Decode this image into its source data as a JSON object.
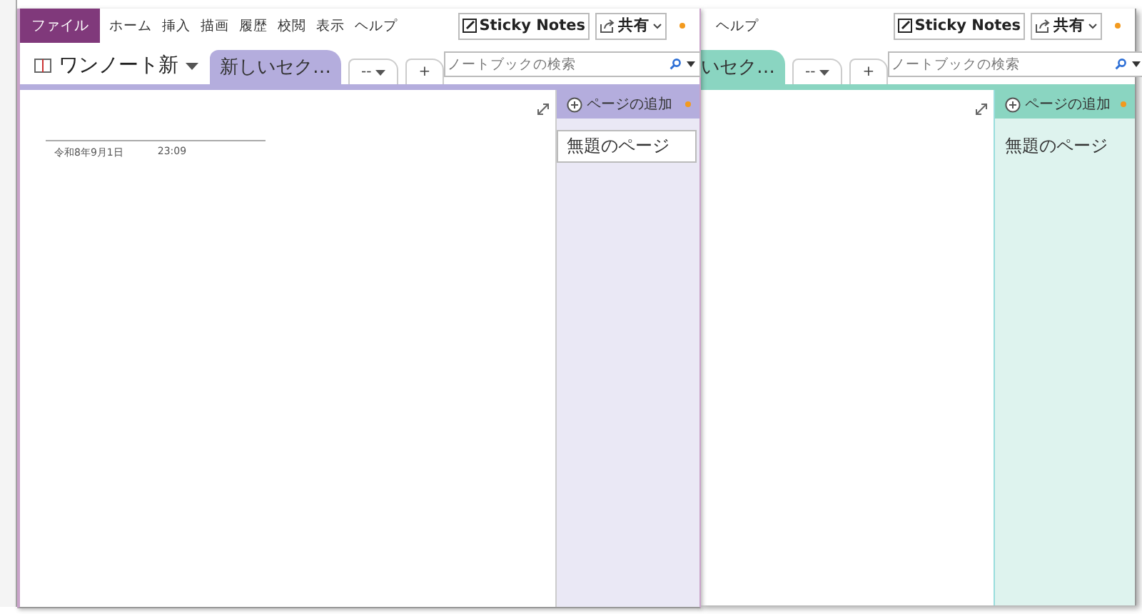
{
  "windows": [
    {
      "kind": "front",
      "color": "#b4addd",
      "file_tab": "ファイル",
      "ribbon_tabs": [
        "ホーム",
        "挿入",
        "描画",
        "履歴",
        "校閲",
        "表示",
        "ヘルプ"
      ],
      "sticky_notes": "Sticky Notes",
      "share": "共有",
      "notebook": "ワンノート新",
      "section_tab": "新しいセク…",
      "more_tab": "--",
      "new_tab": "+",
      "search": {
        "placeholder": "ノートブックの検索"
      },
      "add_page": "ページの追加",
      "pages": [
        {
          "title": "無題のページ",
          "selected": true
        }
      ],
      "page_date": "令和8年9月1日",
      "page_time": "23:09"
    },
    {
      "kind": "back",
      "color": "#8ad5c1",
      "ribbon_tabs": [
        "ヘルプ"
      ],
      "sticky_notes": "Sticky Notes",
      "share": "共有",
      "section_tab": "いセク…",
      "more_tab": "--",
      "new_tab": "+",
      "search": {
        "placeholder": "ノートブックの検索"
      },
      "add_page": "ページの追加",
      "pages": [
        {
          "title": "無題のページ",
          "selected": false
        }
      ]
    }
  ]
}
